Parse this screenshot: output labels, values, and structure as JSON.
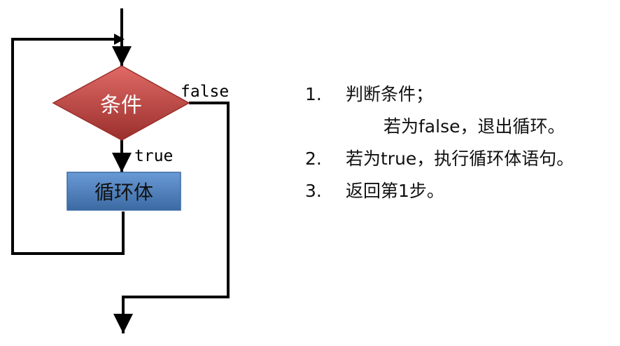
{
  "flowchart": {
    "condition_label": "条件",
    "loop_body_label": "循环体",
    "false_label": "false",
    "true_label": "true",
    "colors": {
      "condition_fill": "#c0504d",
      "condition_fill_light": "#e06a66",
      "condition_fill_dark": "#9a2f2c",
      "loop_body_fill": "#4f81bd",
      "loop_body_fill_light": "#6a9ad6",
      "loop_body_fill_dark": "#3b6aa3",
      "line": "#000000"
    }
  },
  "steps": [
    {
      "number": "1.",
      "text": "判断条件；"
    },
    {
      "number": "",
      "text": "若为false，退出循环。"
    },
    {
      "number": "2.",
      "text": "若为true，执行循环体语句。"
    },
    {
      "number": "3.",
      "text": "返回第1步。"
    }
  ]
}
